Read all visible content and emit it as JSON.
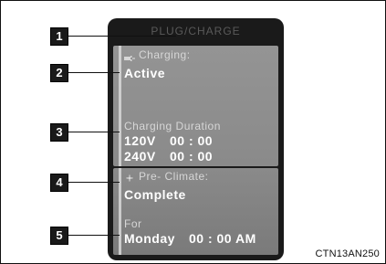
{
  "screen": {
    "header": "PLUG/CHARGE"
  },
  "charging": {
    "label": "Charging:",
    "status": "Active",
    "duration_label": "Charging Duration",
    "rows": [
      {
        "voltage": "120V",
        "time": "00 : 00"
      },
      {
        "voltage": "240V",
        "time": "00 : 00"
      }
    ]
  },
  "preclimate": {
    "label": "Pre- Climate:",
    "status": "Complete",
    "for_label": "For",
    "day": "Monday",
    "time": "00 : 00 AM"
  },
  "callouts": [
    "1",
    "2",
    "3",
    "4",
    "5"
  ],
  "caption": "CTN13AN250",
  "icons": {
    "charging": "plug-icon",
    "preclimate": "fan-icon"
  },
  "colors": {
    "screen_bg": "#1a1a1a",
    "panel": "#8f8f8f",
    "callout_bg": "#1a1a1a",
    "text_white": "#ffffff"
  }
}
